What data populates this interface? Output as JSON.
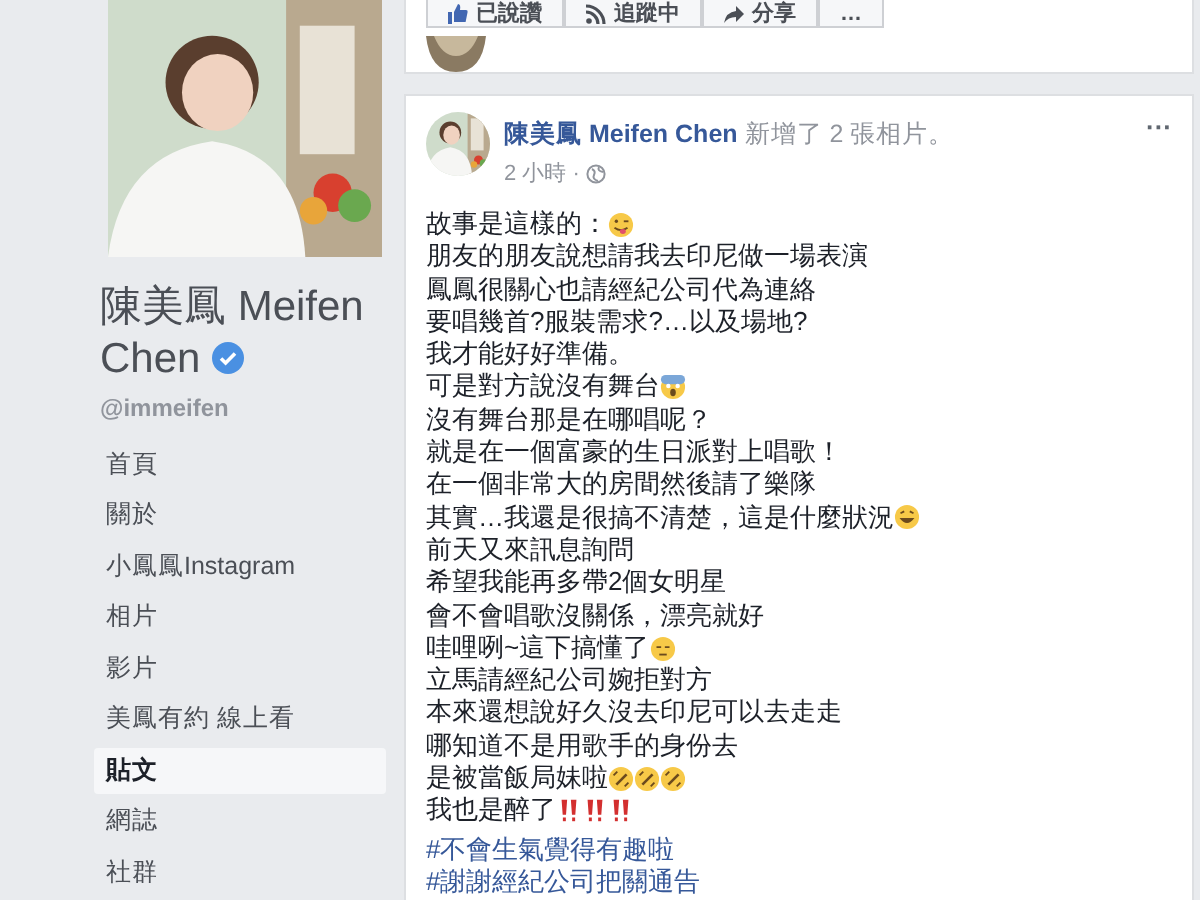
{
  "profile": {
    "name": "陳美鳳 Meifen Chen",
    "verified": true,
    "handle": "@immeifen"
  },
  "nav": [
    {
      "label": "首頁",
      "selected": false
    },
    {
      "label": "關於",
      "selected": false
    },
    {
      "label": "小鳳鳳Instagram",
      "selected": false
    },
    {
      "label": "相片",
      "selected": false
    },
    {
      "label": "影片",
      "selected": false
    },
    {
      "label": "美鳳有約 線上看",
      "selected": false
    },
    {
      "label": "貼文",
      "selected": true
    },
    {
      "label": "網誌",
      "selected": false
    },
    {
      "label": "社群",
      "selected": false
    }
  ],
  "actions": [
    {
      "label": "已說讚",
      "kind": "like"
    },
    {
      "label": "追蹤中",
      "kind": "rss"
    },
    {
      "label": "分享",
      "kind": "share"
    },
    {
      "label": "…",
      "kind": "more"
    }
  ],
  "post": {
    "author": "陳美鳳 Meifen Chen",
    "action": "新增了 2 張相片。",
    "time": "2 小時 ·",
    "menu": "···",
    "lines": [
      {
        "text": "故事是這樣的：",
        "emojis": [
          {
            "kind": "tongue"
          }
        ]
      },
      {
        "text": "朋友的朋友說想請我去印尼做一場表演"
      },
      {
        "text": "鳳鳳很關心也請經紀公司代為連絡"
      },
      {
        "text": "要唱幾首?服裝需求?…以及場地?"
      },
      {
        "text": "我才能好好準備。"
      },
      {
        "text": "可是對方說沒有舞台",
        "emojis": [
          {
            "kind": "scream"
          }
        ]
      },
      {
        "text": "沒有舞台那是在哪唱呢？"
      },
      {
        "text": "就是在一個富豪的生日派對上唱歌！"
      },
      {
        "text": "在一個非常大的房間然後請了樂隊"
      },
      {
        "text": "其實…我還是很搞不清楚，這是什麼狀況",
        "emojis": [
          {
            "kind": "laugh"
          }
        ]
      },
      {
        "text": "前天又來訊息詢問"
      },
      {
        "text": "希望我能再多帶2個女明星"
      },
      {
        "text": "會不會唱歌沒關係，漂亮就好"
      },
      {
        "text": "哇哩咧~這下搞懂了",
        "emojis": [
          {
            "kind": "annoyed"
          }
        ]
      },
      {
        "text": "立馬請經紀公司婉拒對方"
      },
      {
        "text": "本來還想說好久沒去印尼可以去走走"
      },
      {
        "text": "哪知道不是用歌手的身份去"
      },
      {
        "text": "是被當飯局妹啦",
        "emojis": [
          {
            "kind": "rofl"
          },
          {
            "kind": "rofl"
          },
          {
            "kind": "rofl"
          }
        ]
      },
      {
        "text": "我也是醉了",
        "emojis": [
          {
            "kind": "bangbang"
          },
          {
            "kind": "bangbang"
          },
          {
            "kind": "bangbang"
          }
        ]
      }
    ],
    "hashtags": [
      "#不會生氣覺得有趣啦",
      "#謝謝經紀公司把關通告"
    ]
  }
}
